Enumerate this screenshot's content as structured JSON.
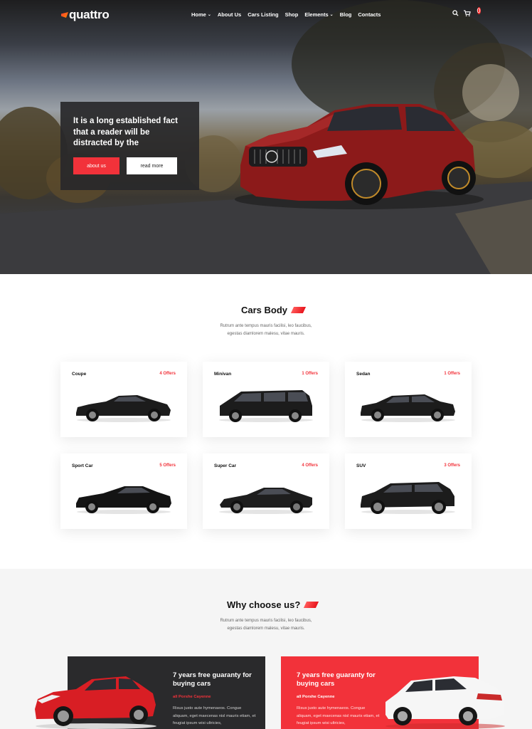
{
  "brand": {
    "logo": "quattro",
    "accent": "#f2323a"
  },
  "nav": {
    "items": [
      {
        "label": "Home",
        "dropdown": true
      },
      {
        "label": "About Us",
        "dropdown": false
      },
      {
        "label": "Cars Listing",
        "dropdown": false
      },
      {
        "label": "Shop",
        "dropdown": false
      },
      {
        "label": "Elements",
        "dropdown": true
      },
      {
        "label": "Blog",
        "dropdown": false
      },
      {
        "label": "Contacts",
        "dropdown": false
      }
    ],
    "cart_count": "0",
    "icons": [
      "search-icon",
      "cart-icon"
    ]
  },
  "hero": {
    "heading": "It is a long established fact that a reader will be distracted by the",
    "primary_button": "about us",
    "secondary_button": "read more"
  },
  "cars_body": {
    "title": "Cars Body",
    "subtitle_line1": "Rutrum ante tempus mauris facilisi, leo faucibus,",
    "subtitle_line2": "egestas diamlorem malesu, vitae mauris.",
    "cards": [
      {
        "name": "Coupe",
        "offers": "4 Offers",
        "shape": "coupe"
      },
      {
        "name": "Minivan",
        "offers": "1 Offers",
        "shape": "minivan"
      },
      {
        "name": "Sedan",
        "offers": "1 Offers",
        "shape": "sedan"
      },
      {
        "name": "Sport Car",
        "offers": "5 Offers",
        "shape": "sport"
      },
      {
        "name": "Super Car",
        "offers": "4 Offers",
        "shape": "super"
      },
      {
        "name": "SUV",
        "offers": "3 Offers",
        "shape": "suv"
      }
    ]
  },
  "why": {
    "title": "Why choose us?",
    "subtitle_line1": "Rutrum ante tempus mauris facilisi, leo faucibus,",
    "subtitle_line2": "egestas diamlorem malesu, vitae mauris.",
    "promos": [
      {
        "title": "7 years free guaranty for buying cars",
        "tag": "all Porshe Cayenne",
        "text": "Risus justo aute hymenaeos. Congue aliquam, eget maecenas nisl mauris etiam, et feugiat ipsum wisi ultricies,",
        "style": "dark"
      },
      {
        "title": "7 years free guaranty for buying cars",
        "tag": "all Porshe Cayenne",
        "text": "Risus justo aute hymenaeos. Congue aliquam, eget maecenas nisl mauris etiam, et feugiat ipsum wisi ultricies,",
        "style": "red"
      }
    ]
  }
}
